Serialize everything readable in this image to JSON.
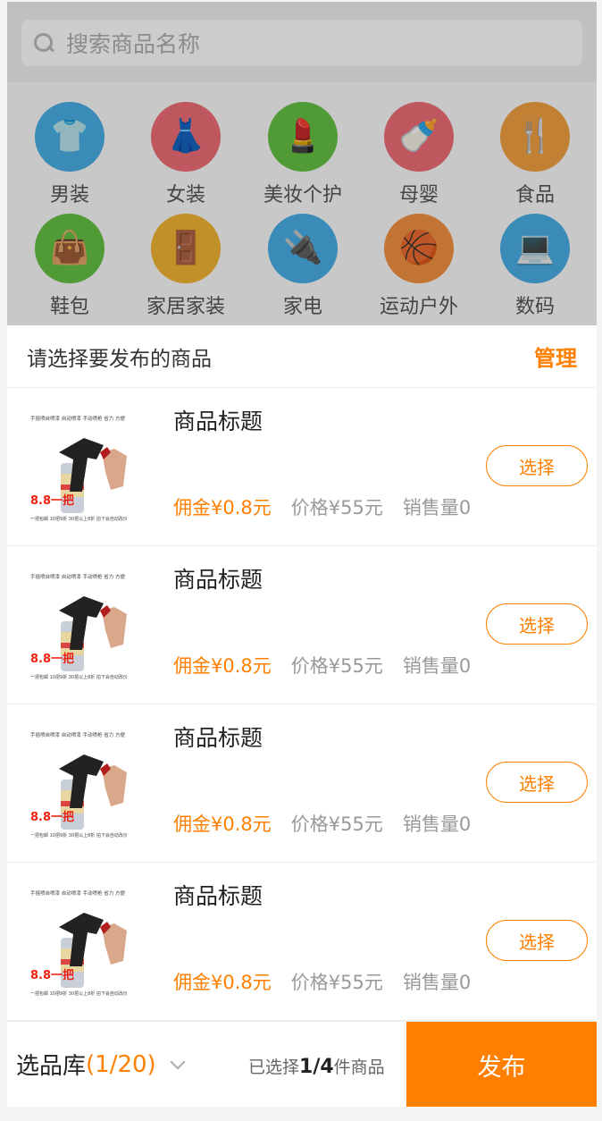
{
  "search": {
    "placeholder": "搜索商品名称"
  },
  "categories": [
    {
      "label": "男装",
      "color": "#49aee6",
      "icon": "tshirt-icon",
      "glyph": "👕"
    },
    {
      "label": "女装",
      "color": "#ee6d76",
      "icon": "dress-icon",
      "glyph": "👗"
    },
    {
      "label": "美妆个护",
      "color": "#66c244",
      "icon": "cosmetics-icon",
      "glyph": "💄"
    },
    {
      "label": "母婴",
      "color": "#ee6d76",
      "icon": "stroller-icon",
      "glyph": "🍼"
    },
    {
      "label": "食品",
      "color": "#f3a143",
      "icon": "fork-knife-icon",
      "glyph": "🍴"
    },
    {
      "label": "鞋包",
      "color": "#66c244",
      "icon": "shoes-bag-icon",
      "glyph": "👜"
    },
    {
      "label": "家居家装",
      "color": "#f3b534",
      "icon": "cabinet-icon",
      "glyph": "🚪"
    },
    {
      "label": "家电",
      "color": "#49aee6",
      "icon": "plug-icon",
      "glyph": "🔌"
    },
    {
      "label": "运动户外",
      "color": "#f39143",
      "icon": "basketball-icon",
      "glyph": "🏀"
    },
    {
      "label": "数码",
      "color": "#49aee6",
      "icon": "laptop-icon",
      "glyph": "💻"
    }
  ],
  "sheet": {
    "title": "请选择要发布的商品",
    "manage": "管理"
  },
  "items": [
    {
      "title": "商品标题",
      "commission": "佣金¥0.8元",
      "price": "价格¥55元",
      "sales": "销售量0",
      "select": "选择",
      "thumb_line1": "手摇喷自喷漆 自动喷漆 手动喷枪 省力 方便",
      "thumb_big": "8.8一把",
      "thumb_line2": "一把包邮 10把9折 30把以上8折 拍下会自动改价"
    },
    {
      "title": "商品标题",
      "commission": "佣金¥0.8元",
      "price": "价格¥55元",
      "sales": "销售量0",
      "select": "选择",
      "thumb_line1": "手摇喷自喷漆 自动喷漆 手动喷枪 省力 方便",
      "thumb_big": "8.8一把",
      "thumb_line2": "一把包邮 10把9折 30把以上8折 拍下会自动改价"
    },
    {
      "title": "商品标题",
      "commission": "佣金¥0.8元",
      "price": "价格¥55元",
      "sales": "销售量0",
      "select": "选择",
      "thumb_line1": "手摇喷自喷漆 自动喷漆 手动喷枪 省力 方便",
      "thumb_big": "8.8一把",
      "thumb_line2": "一把包邮 10把9折 30把以上8折 拍下会自动改价"
    },
    {
      "title": "商品标题",
      "commission": "佣金¥0.8元",
      "price": "价格¥55元",
      "sales": "销售量0",
      "select": "选择",
      "thumb_line1": "手摇喷自喷漆 自动喷漆 手动喷枪 省力 方便",
      "thumb_big": "8.8一把",
      "thumb_line2": "一把包邮 10把9折 30把以上8折 拍下会自动改价"
    }
  ],
  "footer": {
    "library_label": "选品库",
    "library_count": "(1/20)",
    "selected_prefix": "已选择",
    "selected_count": "1/4",
    "selected_suffix": "件商品",
    "publish": "发布"
  },
  "colors": {
    "accent": "#ff7f00"
  }
}
